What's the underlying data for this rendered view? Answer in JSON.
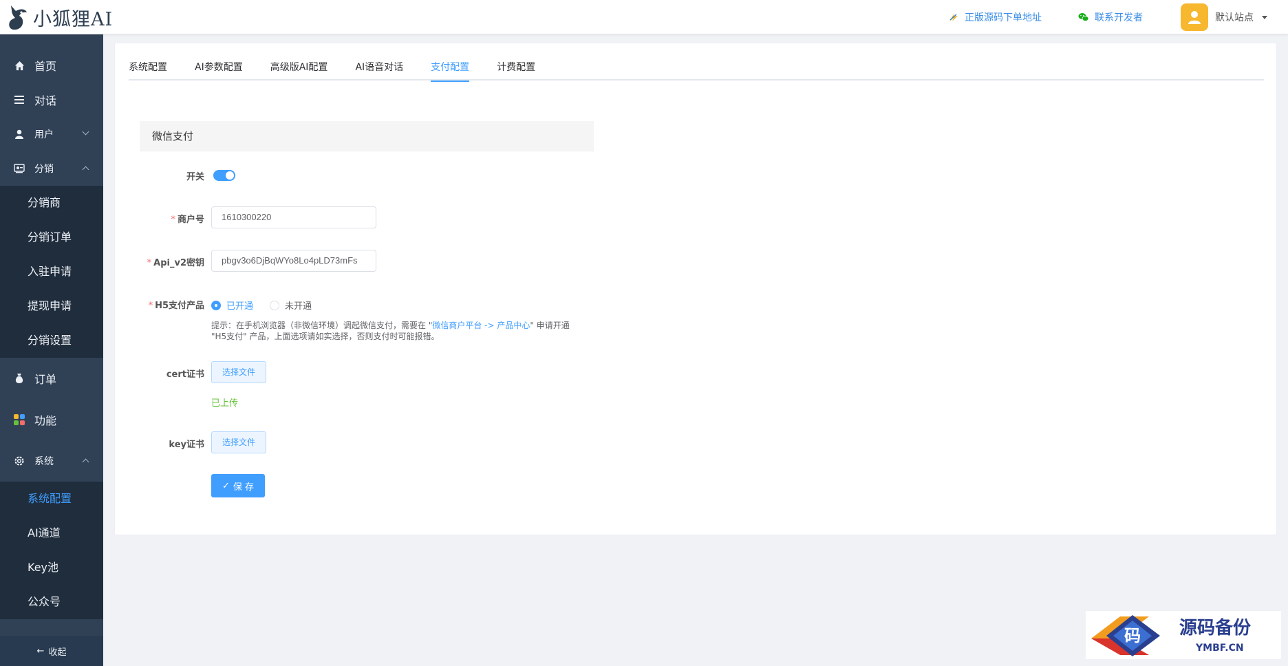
{
  "header": {
    "logo_text": "小狐狸AI",
    "link_source": "正版源码下单地址",
    "link_dev": "联系开发者",
    "user_name": "默认站点"
  },
  "sidebar": {
    "items": [
      {
        "label": "首页"
      },
      {
        "label": "对话"
      },
      {
        "label": "用户"
      },
      {
        "label": "分销"
      }
    ],
    "distribution_sub": [
      "分销商",
      "分销订单",
      "入驻申请",
      "提现申请",
      "分销设置"
    ],
    "orders": "订单",
    "features": "功能",
    "system": "系统",
    "system_sub": [
      "系统配置",
      "AI通道",
      "Key池",
      "公众号"
    ],
    "collapse": "收起"
  },
  "tabs": [
    "系统配置",
    "AI参数配置",
    "高级版AI配置",
    "AI语音对话",
    "支付配置",
    "计费配置"
  ],
  "active_tab": "支付配置",
  "form": {
    "section_title": "微信支付",
    "switch_label": "开关",
    "switch_on": true,
    "mch_label": "商户号",
    "mch_value": "1610300220",
    "key_label": "Api_v2密钥",
    "key_value": "pbgv3o6DjBqWYo8Lo4pLD73mFs",
    "h5_label": "H5支付产品",
    "h5_on": "已开通",
    "h5_off": "未开通",
    "hint_a": "提示：在手机浏览器（非微信环境）调起微信支付，需要在 \"",
    "hint_link": "微信商户平台 -> 产品中心",
    "hint_b": "\" 申请开通 \"H5支付\" 产品，上面选项请如实选择，否则支付时可能报错。",
    "cert_label": "cert证书",
    "choose_file": "选择文件",
    "uploaded": "已上传",
    "keycert_label": "key证书",
    "save": "保 存"
  },
  "watermark": {
    "title": "源码备份",
    "domain": "YMBF.CN",
    "glyph": "码"
  },
  "colors": {
    "primary": "#409eff",
    "sidebar": "#304156",
    "submenu": "#1f2d3d",
    "success": "#67c23a"
  }
}
